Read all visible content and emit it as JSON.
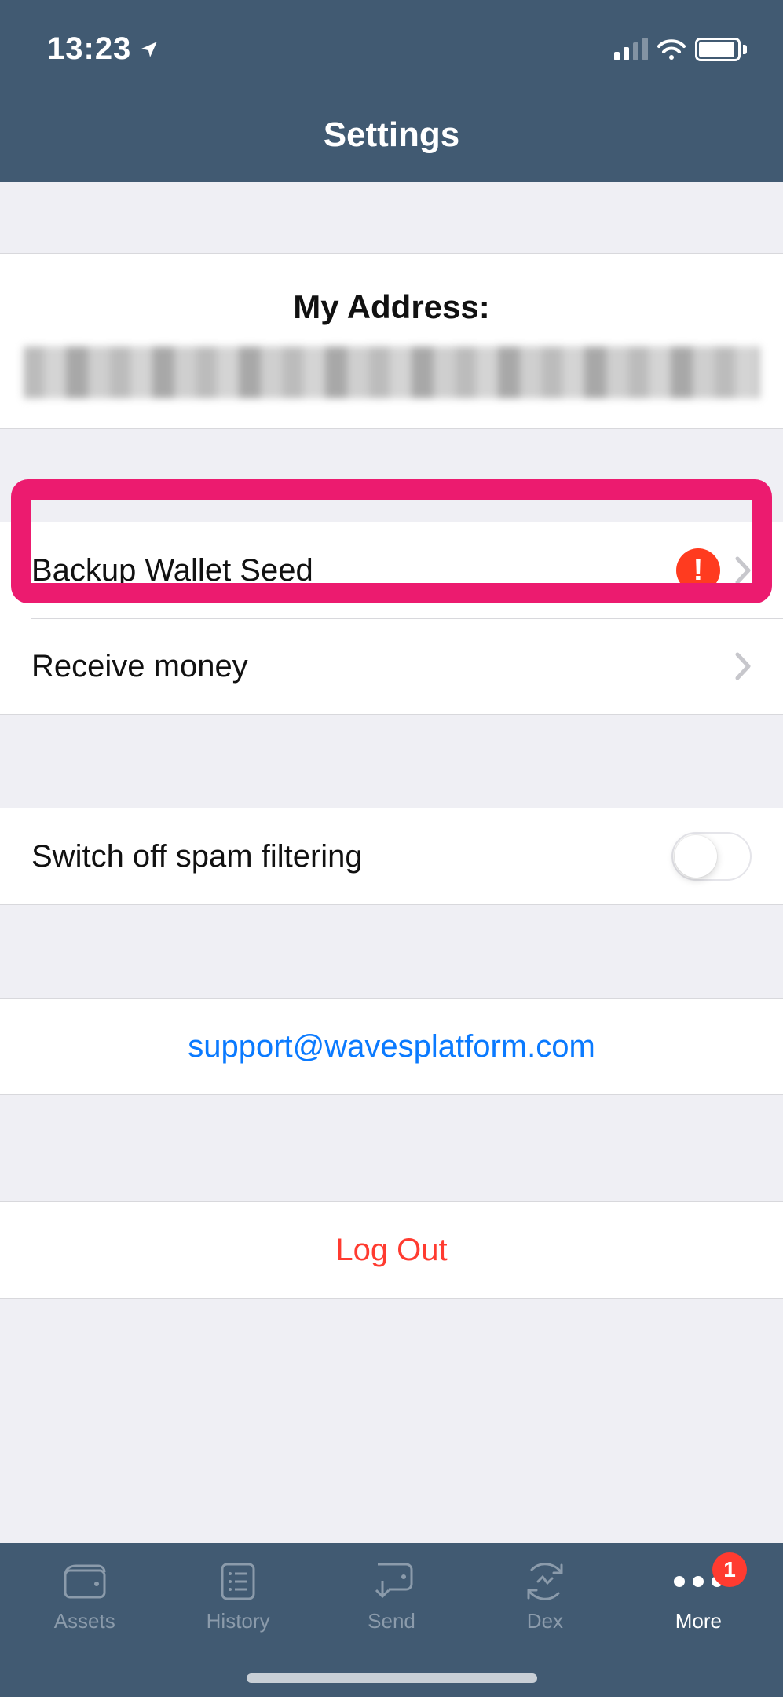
{
  "status": {
    "time": "13:23"
  },
  "header": {
    "title": "Settings"
  },
  "address": {
    "label": "My Address:"
  },
  "rows": {
    "backup": {
      "label": "Backup Wallet Seed",
      "badge_symbol": "!"
    },
    "receive": {
      "label": "Receive money"
    },
    "spam": {
      "label": "Switch off spam filtering",
      "on": false
    },
    "support": {
      "email": "support@wavesplatform.com"
    },
    "logout": {
      "label": "Log Out"
    }
  },
  "tabs": [
    {
      "id": "assets",
      "label": "Assets"
    },
    {
      "id": "history",
      "label": "History"
    },
    {
      "id": "send",
      "label": "Send"
    },
    {
      "id": "dex",
      "label": "Dex"
    },
    {
      "id": "more",
      "label": "More",
      "badge": "1",
      "active": true
    }
  ],
  "colors": {
    "header_bg": "#415a72",
    "accent_pink": "#ec1b6f",
    "link": "#0a7aff",
    "danger": "#ff3b30",
    "alert": "#ff3b1f"
  }
}
